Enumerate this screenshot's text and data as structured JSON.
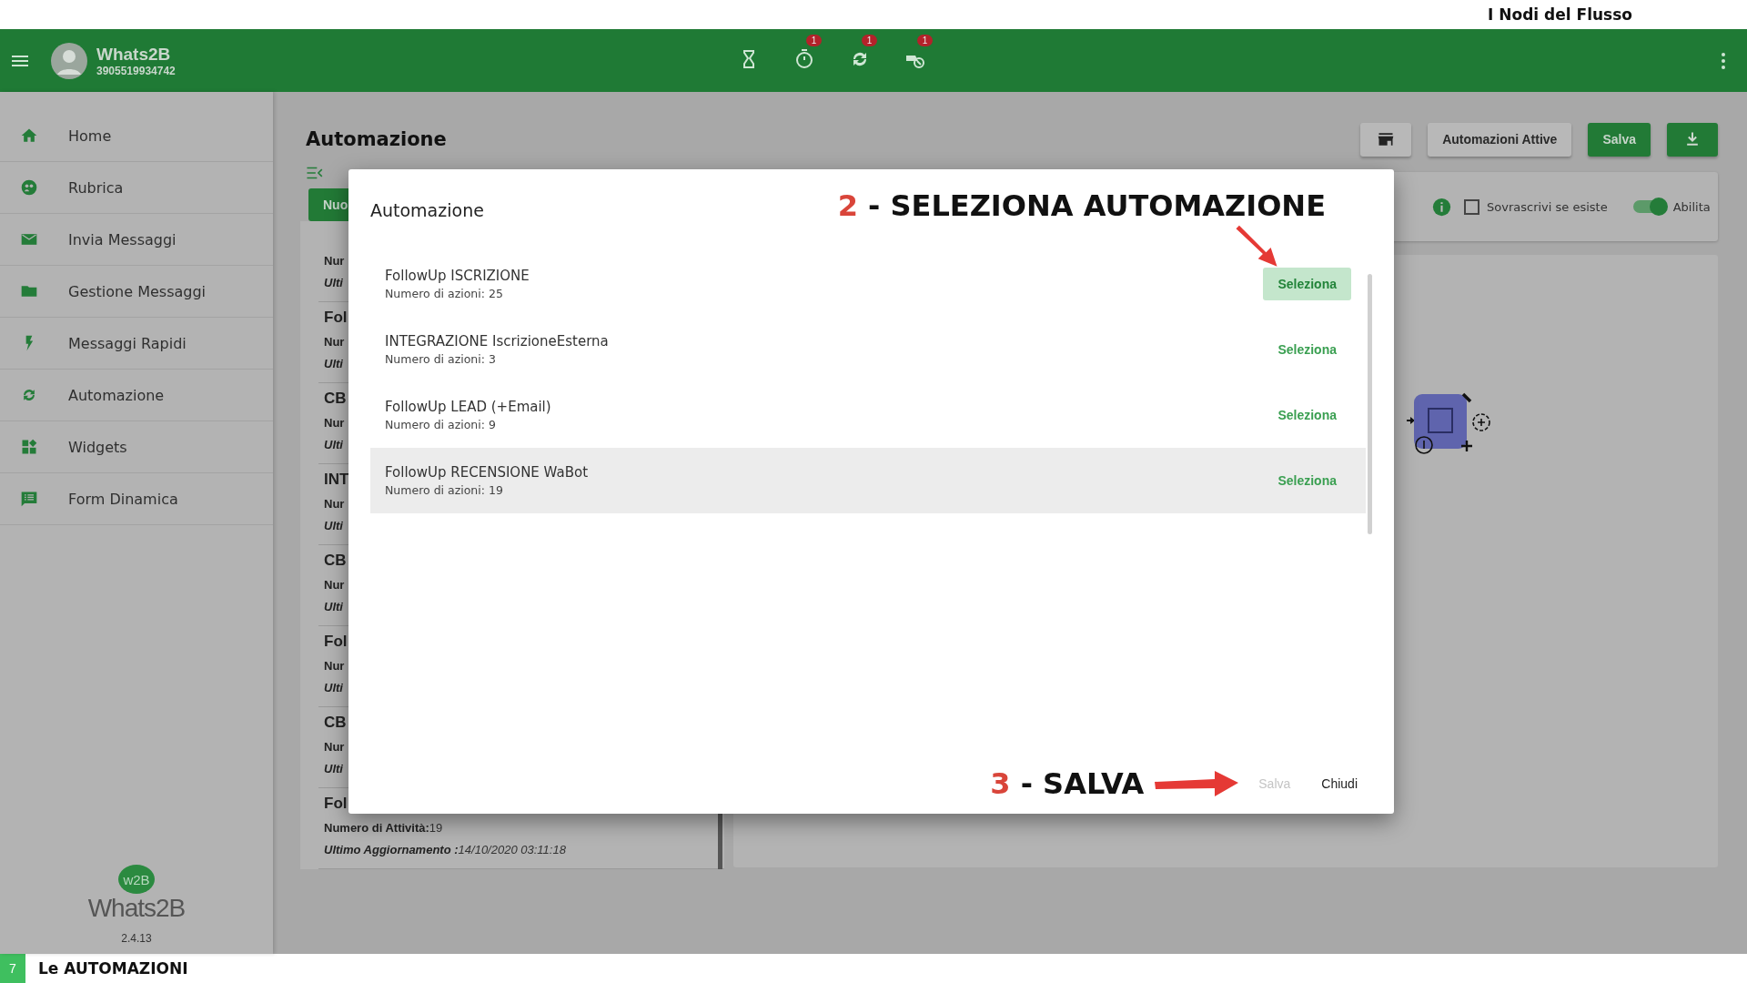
{
  "top_banner": {
    "title": "I Nodi del Flusso"
  },
  "app_bar": {
    "name": "Whats2B",
    "phone": "3905519934742",
    "actions": [
      {
        "kind": "hourglass"
      },
      {
        "kind": "timer",
        "badge": "1"
      },
      {
        "kind": "sync",
        "badge": "1"
      },
      {
        "kind": "bot",
        "badge": "1"
      }
    ]
  },
  "sidebar": {
    "items": [
      {
        "label": "Home"
      },
      {
        "label": "Rubrica"
      },
      {
        "label": "Invia Messaggi"
      },
      {
        "label": "Gestione Messaggi"
      },
      {
        "label": "Messaggi Rapidi"
      },
      {
        "label": "Automazione"
      },
      {
        "label": "Widgets"
      },
      {
        "label": "Form Dinamica"
      }
    ],
    "logo": {
      "mark": "w2B",
      "name": "Whats2B"
    },
    "version": "2.4.13"
  },
  "page": {
    "title": "Automazione",
    "toolbar": [
      {
        "kind": "store"
      },
      {
        "kind": "plain",
        "label": "Automazioni Attive"
      },
      {
        "kind": "primary",
        "label": "Salva"
      },
      {
        "kind": "download"
      }
    ],
    "new_button": "Nuo",
    "automations": [
      {
        "count_label": "Nur",
        "updated_label": "Ulti"
      },
      {
        "title": "Fol",
        "count_label": "Nur",
        "updated_label": "Ulti"
      },
      {
        "title": "CB",
        "count_label": "Nur",
        "updated_label": "Ulti"
      },
      {
        "title": "INT",
        "count_label": "Nur",
        "updated_label": "Ulti"
      },
      {
        "title": "CB",
        "count_label": "Nur",
        "updated_label": "Ulti"
      },
      {
        "title": "Fol",
        "count_label": "Nur",
        "updated_label": "Ulti"
      },
      {
        "title": "CB",
        "count_label": "Nur",
        "updated_label": "Ulti"
      },
      {
        "title": "Fol",
        "count_label": "Numero di Attività:",
        "count_value": "19",
        "updated_label": "Ultimo Aggiornamento :",
        "updated_value": "14/10/2020 03:11:18"
      }
    ],
    "options": {
      "overwrite": {
        "label": "Sovrascrivi se esiste",
        "checked": false
      },
      "enable": {
        "label": "Abilita",
        "on": true
      }
    }
  },
  "dialog": {
    "title": "Automazione",
    "annotation_top": {
      "number": "2",
      "text": "- SELEZIONA AUTOMAZIONE"
    },
    "rows": [
      {
        "name": "FollowUp ISCRIZIONE",
        "actions": "Numero di azioni: 25",
        "button": "Seleziona",
        "highlighted": false,
        "button_focused": true
      },
      {
        "name": "INTEGRAZIONE IscrizioneEsterna",
        "actions": "Numero di azioni: 3",
        "button": "Seleziona",
        "highlighted": false,
        "button_focused": false
      },
      {
        "name": "FollowUp LEAD (+Email)",
        "actions": "Numero di azioni: 9",
        "button": "Seleziona",
        "highlighted": false,
        "button_focused": false
      },
      {
        "name": "FollowUp RECENSIONE WaBot",
        "actions": "Numero di azioni: 19",
        "button": "Seleziona",
        "highlighted": true,
        "button_focused": false
      }
    ],
    "annotation_bottom": {
      "number": "3",
      "text": "- SALVA"
    },
    "buttons": [
      {
        "label": "Salva",
        "disabled": true
      },
      {
        "label": "Chiudi",
        "disabled": false
      }
    ]
  },
  "footer": {
    "number": "7",
    "title": "Le AUTOMAZIONI"
  }
}
